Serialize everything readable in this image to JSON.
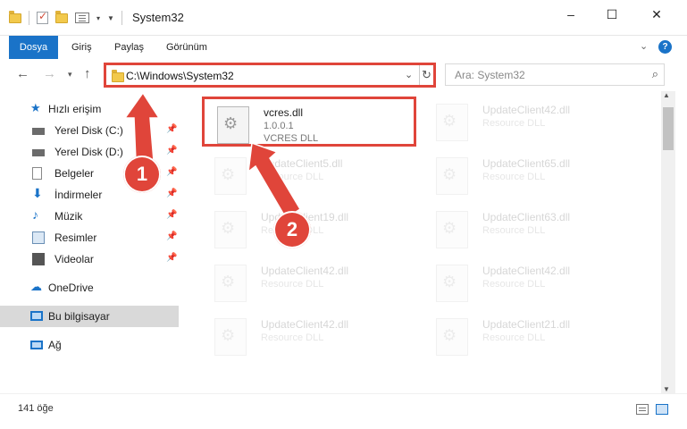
{
  "window": {
    "title": "System32",
    "controls": [
      "–",
      "☐",
      "✕"
    ]
  },
  "ribbon": {
    "tabs": [
      "Dosya",
      "Giriş",
      "Paylaş",
      "Görünüm"
    ],
    "help": "?"
  },
  "nav": {
    "address": "C:\\Windows\\System32",
    "search_placeholder": "Ara: System32"
  },
  "sidebar": {
    "items": [
      {
        "label": "Hızlı erişim"
      },
      {
        "label": "Yerel Disk (C:)"
      },
      {
        "label": "Yerel Disk (D:)"
      },
      {
        "label": "Belgeler"
      },
      {
        "label": "İndirmeler"
      },
      {
        "label": "Müzik"
      },
      {
        "label": "Resimler"
      },
      {
        "label": "Videolar"
      },
      {
        "label": "OneDrive"
      },
      {
        "label": "Bu bilgisayar"
      },
      {
        "label": "Ağ"
      }
    ]
  },
  "files": [
    {
      "name": "vcres.dll",
      "version": "1.0.0.1",
      "desc": "VCRES DLL"
    },
    {
      "name": "UpdateClient42.dll",
      "version": "",
      "desc": "Resource DLL"
    },
    {
      "name": "UpdateClient5.dll",
      "version": "",
      "desc": "Resource DLL"
    },
    {
      "name": "UpdateClient65.dll",
      "version": "",
      "desc": "Resource DLL"
    },
    {
      "name": "UpdateClient19.dll",
      "version": "",
      "desc": "Resource DLL"
    },
    {
      "name": "UpdateClient63.dll",
      "version": "",
      "desc": "Resource DLL"
    },
    {
      "name": "UpdateClient42.dll",
      "version": "",
      "desc": "Resource DLL"
    },
    {
      "name": "UpdateClient42.dll",
      "version": "",
      "desc": "Resource DLL"
    },
    {
      "name": "UpdateClient42.dll",
      "version": "",
      "desc": "Resource DLL"
    },
    {
      "name": "UpdateClient21.dll",
      "version": "",
      "desc": "Resource DLL"
    }
  ],
  "status": {
    "count": "141 öğe"
  },
  "callouts": [
    "1",
    "2"
  ],
  "colors": {
    "accent": "#1a73c8",
    "highlight": "#e0453a"
  }
}
